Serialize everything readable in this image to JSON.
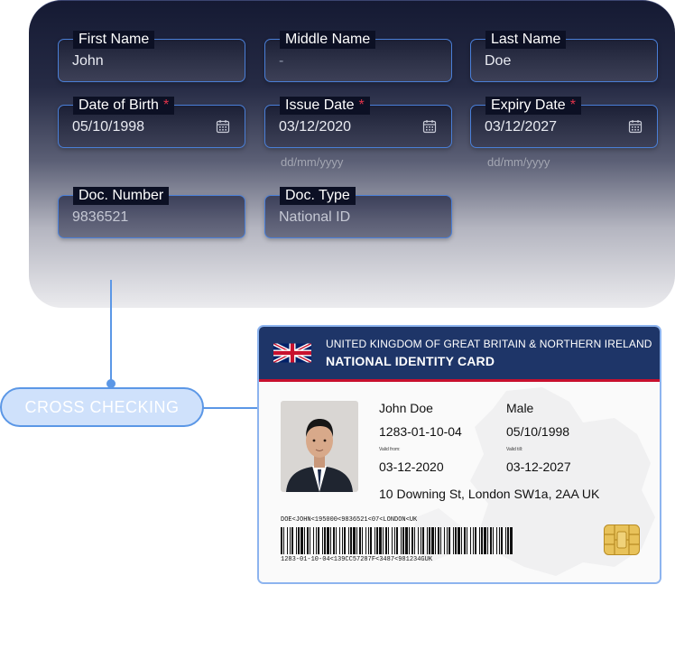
{
  "form": {
    "fields": [
      {
        "label": "First Name",
        "value": "John",
        "required": false
      },
      {
        "label": "Middle Name",
        "value": "-",
        "required": false
      },
      {
        "label": "Last Name",
        "value": "Doe",
        "required": false
      },
      {
        "label": "Date of Birth",
        "value": "05/10/1998",
        "required": true,
        "icon": "calendar-icon"
      },
      {
        "label": "Issue Date",
        "value": "03/12/2020",
        "required": true,
        "icon": "calendar-icon"
      },
      {
        "label": "Expiry Date",
        "value": "03/12/2027",
        "required": true,
        "icon": "calendar-icon"
      },
      {
        "label": "Doc. Number",
        "value": "9836521",
        "required": false
      },
      {
        "label": "Doc. Type",
        "value": "National ID",
        "required": false
      }
    ],
    "required_marker": "*",
    "date_hint": "dd/mm/yyyy"
  },
  "cross_check": {
    "label": "CROSS CHECKING"
  },
  "card": {
    "country": "UNITED KINGDOM OF GREAT BRITAIN & NORTHERN IRELAND",
    "title": "NATIONAL IDENTITY CARD",
    "name": "John Doe",
    "sex": "Male",
    "id_number": "1283-01-10-04",
    "birth_date": "05/10/1998",
    "valid_from_label": "Valid from:",
    "valid_from": "03-12-2020",
    "valid_till_label": "Valid till:",
    "valid_till": "03-12-2027",
    "address": "10 Downing St, London SW1a, 2AA UK",
    "mrz_line1": "DOE<JOHN<195000<9836521<07<LONDON<UK",
    "mrz_line2": "1283-01-10-04<139CC57287F<3487<981234GUK",
    "colors": {
      "header": "#1e3568",
      "stripe": "#c8102e",
      "border": "#8db4ef"
    }
  },
  "colors": {
    "accent": "#5b97e6",
    "required": "#e0334a",
    "label_bg": "#0c1024"
  }
}
